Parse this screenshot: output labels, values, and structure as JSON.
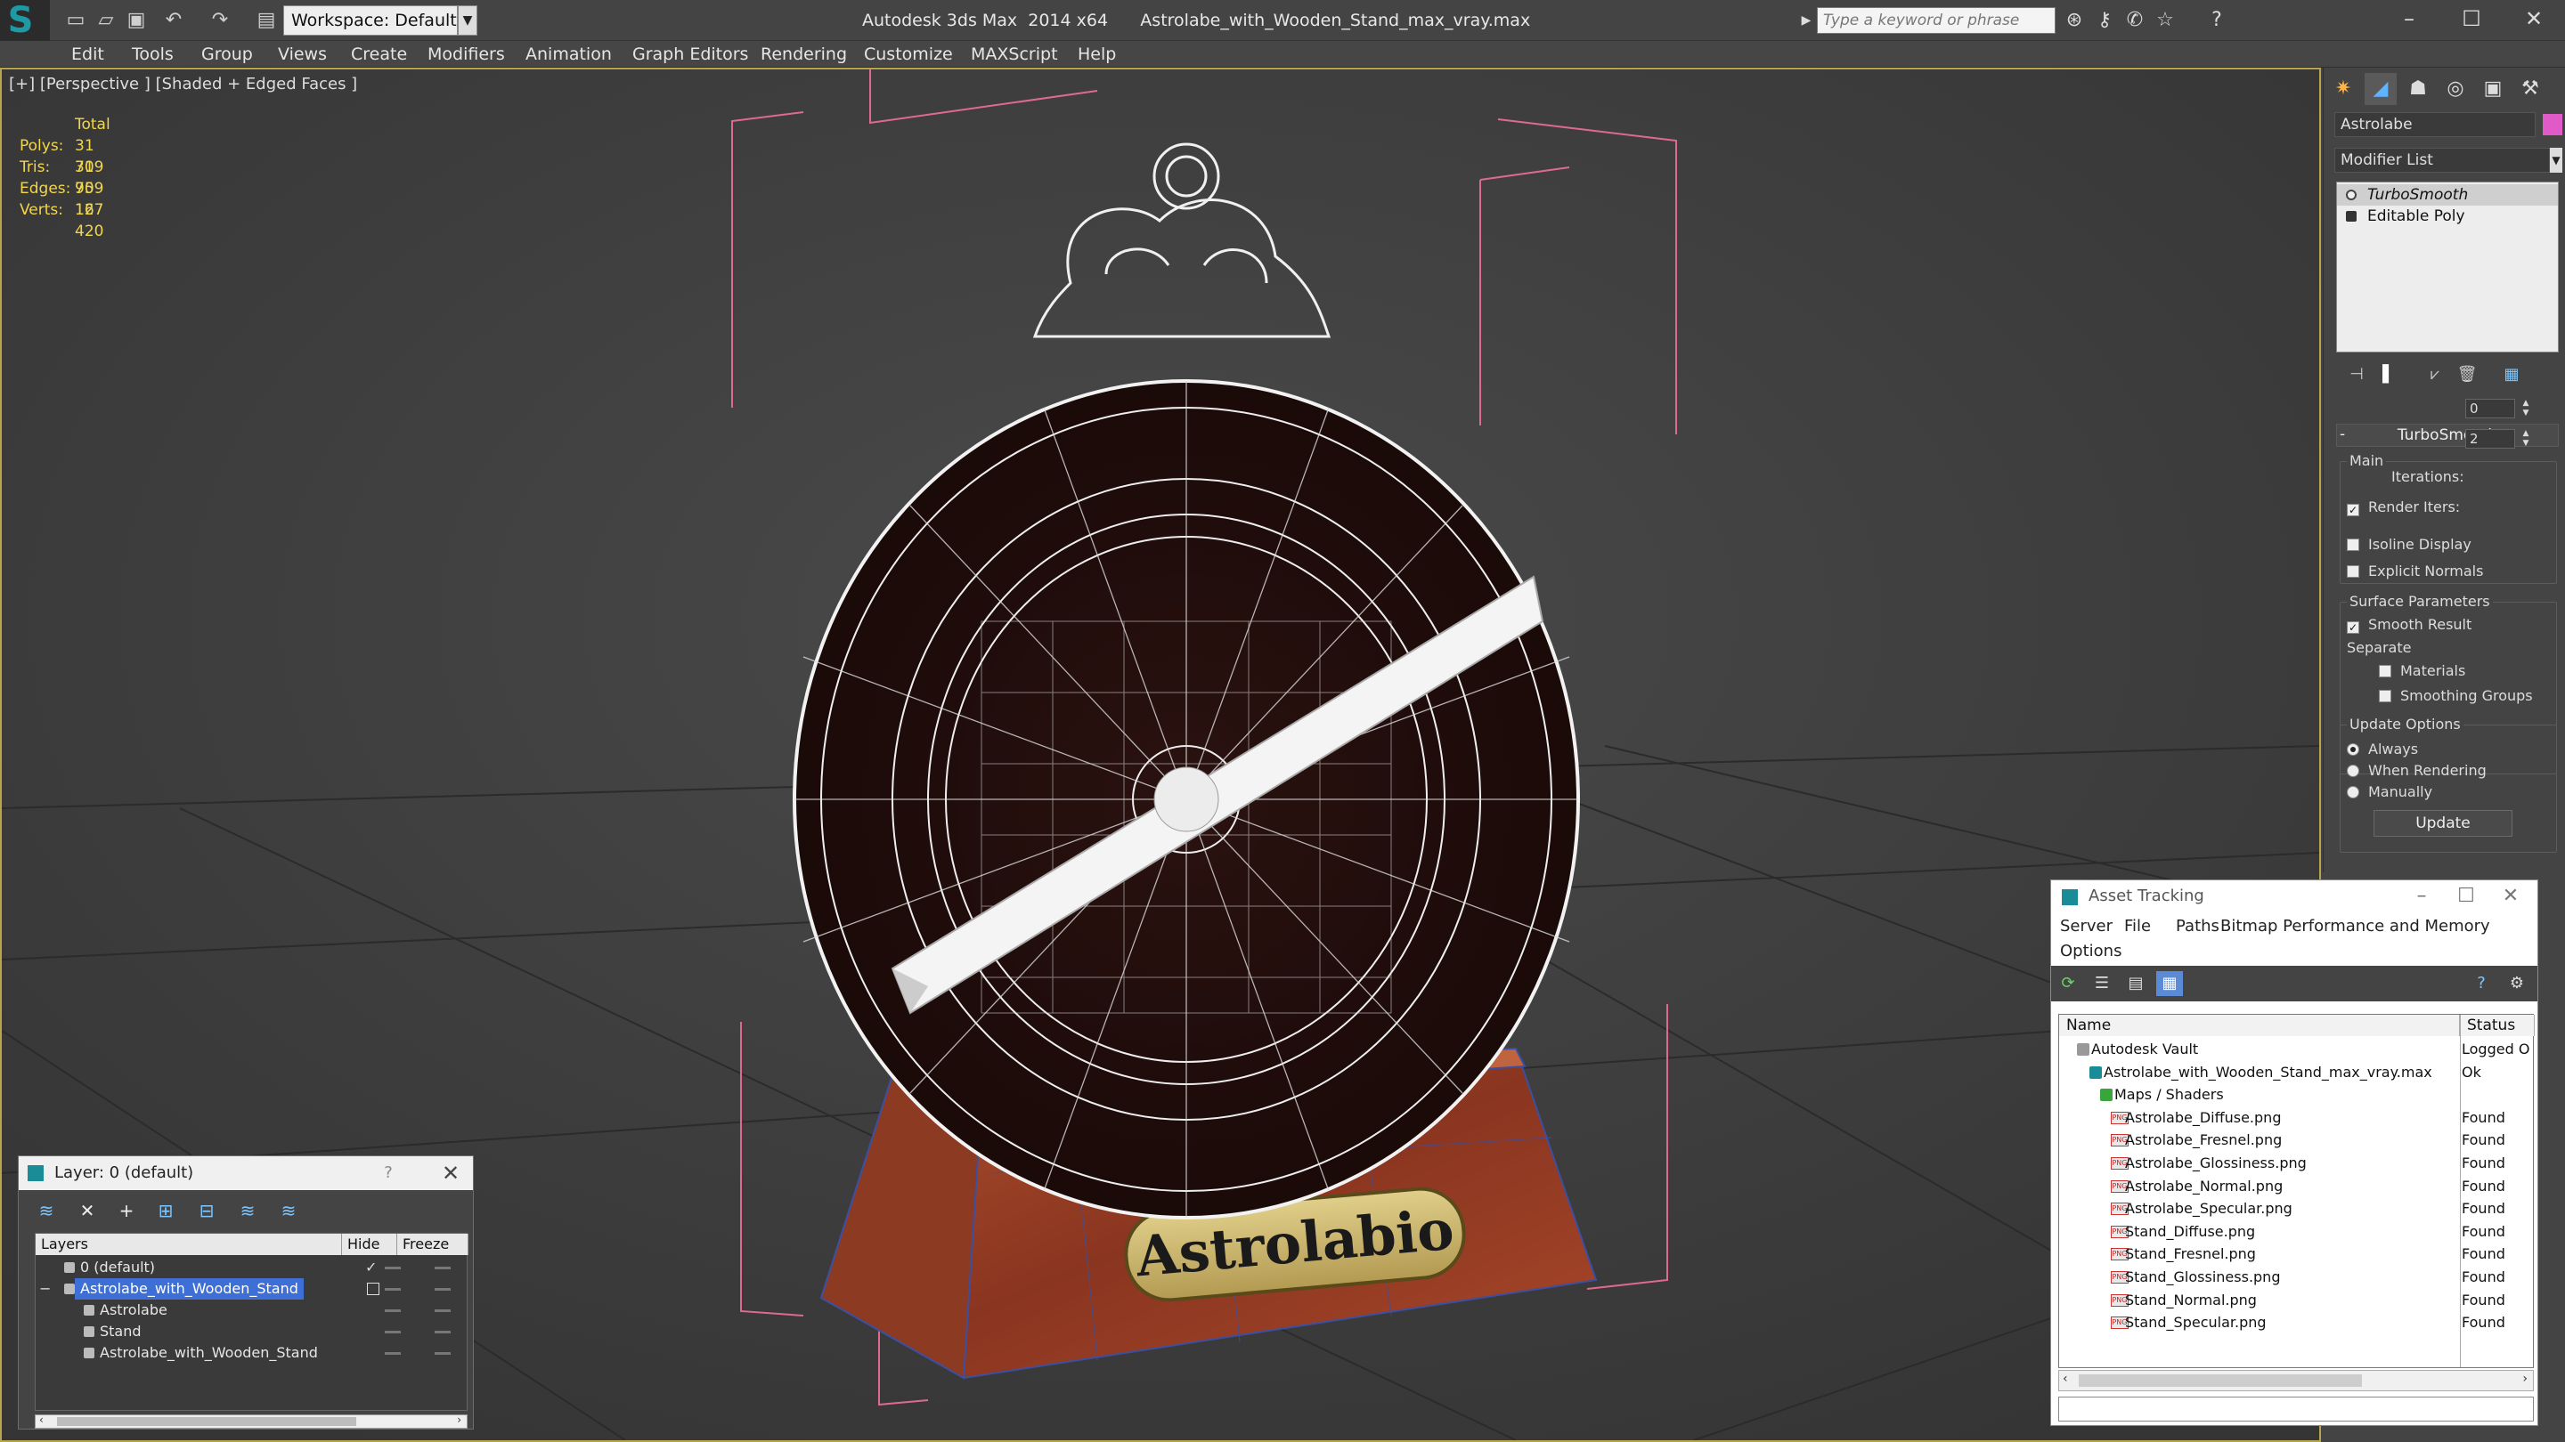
{
  "titlebar": {
    "workspace": "Workspace: Default",
    "app_title": "Autodesk 3ds Max  2014 x64      Astrolabe_with_Wooden_Stand_max_vray.max",
    "search_placeholder": "Type a keyword or phrase"
  },
  "menu": [
    "Edit",
    "Tools",
    "Group",
    "Views",
    "Create",
    "Modifiers",
    "Animation",
    "Graph Editors",
    "Rendering",
    "Customize",
    "MAXScript",
    "Help"
  ],
  "viewport": {
    "label": "[+] [Perspective ] [Shaded + Edged Faces ]",
    "stats": {
      "header": "Total",
      "polys_label": "Polys:",
      "polys": "31 709",
      "tris_label": "Tris:",
      "tris": "31 709",
      "edges_label": "Edges:",
      "edges": "95 127",
      "verts_label": "Verts:",
      "verts": "16 420"
    },
    "plate_text": "Astrolabio"
  },
  "command_panel": {
    "object_name": "Astrolabe",
    "object_color": "#e05ac8",
    "modifier_list": "Modifier List",
    "stack": [
      "TurboSmooth",
      "Editable Poly"
    ],
    "rollout_title": "TurboSmooth",
    "main_group": "Main",
    "iterations_label": "Iterations:",
    "iterations": "0",
    "render_iters_label": "Render Iters:",
    "render_iters": "2",
    "isoline": "Isoline Display",
    "explicit_normals": "Explicit Normals",
    "surface_group": "Surface Parameters",
    "smooth_result": "Smooth Result",
    "separate": "Separate",
    "materials": "Materials",
    "smoothing_groups": "Smoothing Groups",
    "update_group": "Update Options",
    "always": "Always",
    "when_rendering": "When Rendering",
    "manually": "Manually",
    "update_button": "Update"
  },
  "layer_window": {
    "title": "Layer: 0 (default)",
    "help": "?",
    "columns": [
      "Layers",
      "Hide",
      "Freeze"
    ],
    "rows": [
      {
        "name": "0 (default)",
        "indent": 0
      },
      {
        "name": "Astrolabe_with_Wooden_Stand",
        "indent": 0
      },
      {
        "name": "Astrolabe",
        "indent": 1
      },
      {
        "name": "Stand",
        "indent": 1
      },
      {
        "name": "Astrolabe_with_Wooden_Stand",
        "indent": 1
      }
    ]
  },
  "asset_window": {
    "title": "Asset Tracking",
    "menu": [
      "Server",
      "File",
      "Paths",
      "Bitmap Performance and Memory",
      "Options"
    ],
    "columns": [
      "Name",
      "Status"
    ],
    "rows": [
      {
        "name": "Autodesk Vault",
        "status": "Logged O",
        "level": 0
      },
      {
        "name": "Astrolabe_with_Wooden_Stand_max_vray.max",
        "status": "Ok",
        "level": 1
      },
      {
        "name": "Maps / Shaders",
        "status": "",
        "level": 2
      },
      {
        "name": "Astrolabe_Diffuse.png",
        "status": "Found",
        "level": 3
      },
      {
        "name": "Astrolabe_Fresnel.png",
        "status": "Found",
        "level": 3
      },
      {
        "name": "Astrolabe_Glossiness.png",
        "status": "Found",
        "level": 3
      },
      {
        "name": "Astrolabe_Normal.png",
        "status": "Found",
        "level": 3
      },
      {
        "name": "Astrolabe_Specular.png",
        "status": "Found",
        "level": 3
      },
      {
        "name": "Stand_Diffuse.png",
        "status": "Found",
        "level": 3
      },
      {
        "name": "Stand_Fresnel.png",
        "status": "Found",
        "level": 3
      },
      {
        "name": "Stand_Glossiness.png",
        "status": "Found",
        "level": 3
      },
      {
        "name": "Stand_Normal.png",
        "status": "Found",
        "level": 3
      },
      {
        "name": "Stand_Specular.png",
        "status": "Found",
        "level": 3
      }
    ]
  }
}
